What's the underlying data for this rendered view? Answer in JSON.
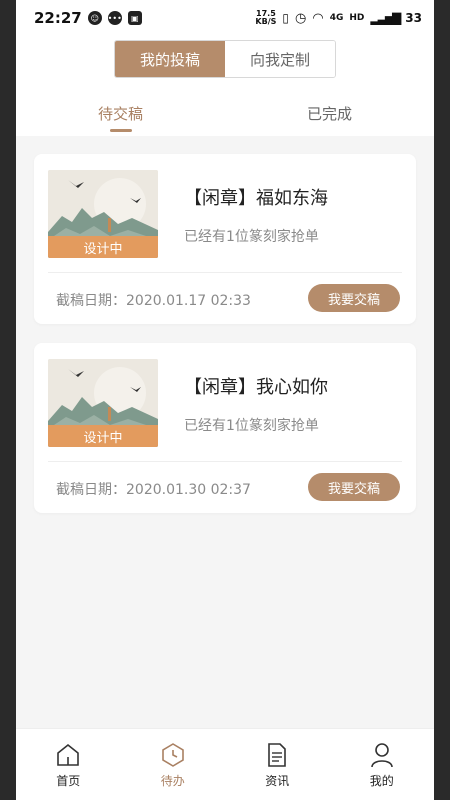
{
  "status_bar": {
    "time": "22:27",
    "speed_value": "17.5",
    "speed_unit": "KB/S",
    "network": "4G",
    "hd": "HD",
    "battery": "33"
  },
  "header": {
    "segment": [
      {
        "label": "我的投稿",
        "active": true
      },
      {
        "label": "向我定制",
        "active": false
      }
    ],
    "tabs": [
      {
        "label": "待交稿",
        "active": true
      },
      {
        "label": "已完成",
        "active": false
      }
    ]
  },
  "cards": [
    {
      "badge": "设计中",
      "title": "【闲章】福如东海",
      "subtitle": "已经有1位篆刻家抢单",
      "deadline": "截稿日期：2020.01.17 02:33",
      "action": "我要交稿"
    },
    {
      "badge": "设计中",
      "title": "【闲章】我心如你",
      "subtitle": "已经有1位篆刻家抢单",
      "deadline": "截稿日期：2020.01.30 02:37",
      "action": "我要交稿"
    }
  ],
  "bottom_nav": [
    {
      "label": "首页",
      "icon": "home-icon",
      "active": false
    },
    {
      "label": "待办",
      "icon": "clock-icon",
      "active": true
    },
    {
      "label": "资讯",
      "icon": "document-icon",
      "active": false
    },
    {
      "label": "我的",
      "icon": "user-icon",
      "active": false
    }
  ],
  "colors": {
    "accent": "#b58c6b",
    "badge": "#e39b5e"
  }
}
